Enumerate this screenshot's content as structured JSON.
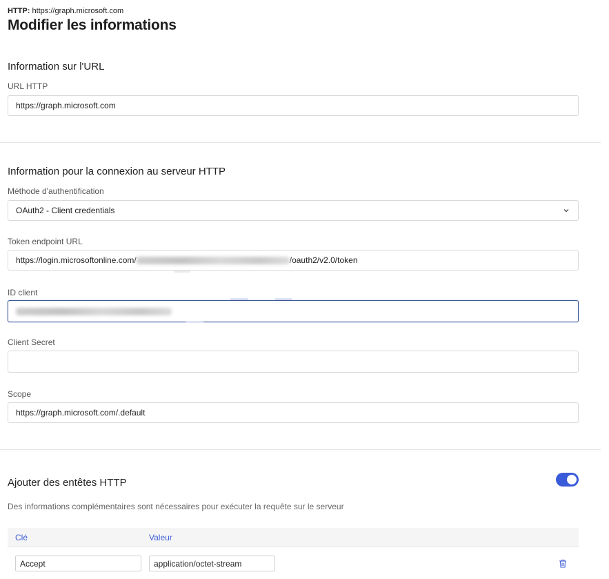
{
  "header": {
    "crumb_prefix": "HTTP:",
    "crumb_value": "https://graph.microsoft.com",
    "title": "Modifier les informations"
  },
  "url_section": {
    "title": "Information sur l'URL",
    "url_label": "URL HTTP",
    "url_value": "https://graph.microsoft.com"
  },
  "connection_section": {
    "title": "Information pour la connexion au serveur HTTP",
    "auth_label": "Méthode d'authentification",
    "auth_value": "OAuth2 - Client credentials",
    "token_label": "Token endpoint URL",
    "token_prefix": "https://login.microsoftonline.com/",
    "token_suffix": "/oauth2/v2.0/token",
    "client_id_label": "ID client",
    "client_secret_label": "Client Secret",
    "client_secret_value": "",
    "scope_label": "Scope",
    "scope_value": "https://graph.microsoft.com/.default"
  },
  "headers_section": {
    "title": "Ajouter des entêtes HTTP",
    "toggle_on": true,
    "description": "Des informations complémentaires sont nécessaires pour exécuter la requête sur le serveur",
    "columns": [
      "Clé",
      "Valeur"
    ],
    "rows": [
      {
        "key": "Accept",
        "value": "application/octet-stream"
      }
    ]
  },
  "icons": {
    "dropdown": "chevron-down-icon",
    "delete": "trash-icon"
  },
  "colors": {
    "accent": "#3a5bd9",
    "focus_border": "#3b5998"
  }
}
